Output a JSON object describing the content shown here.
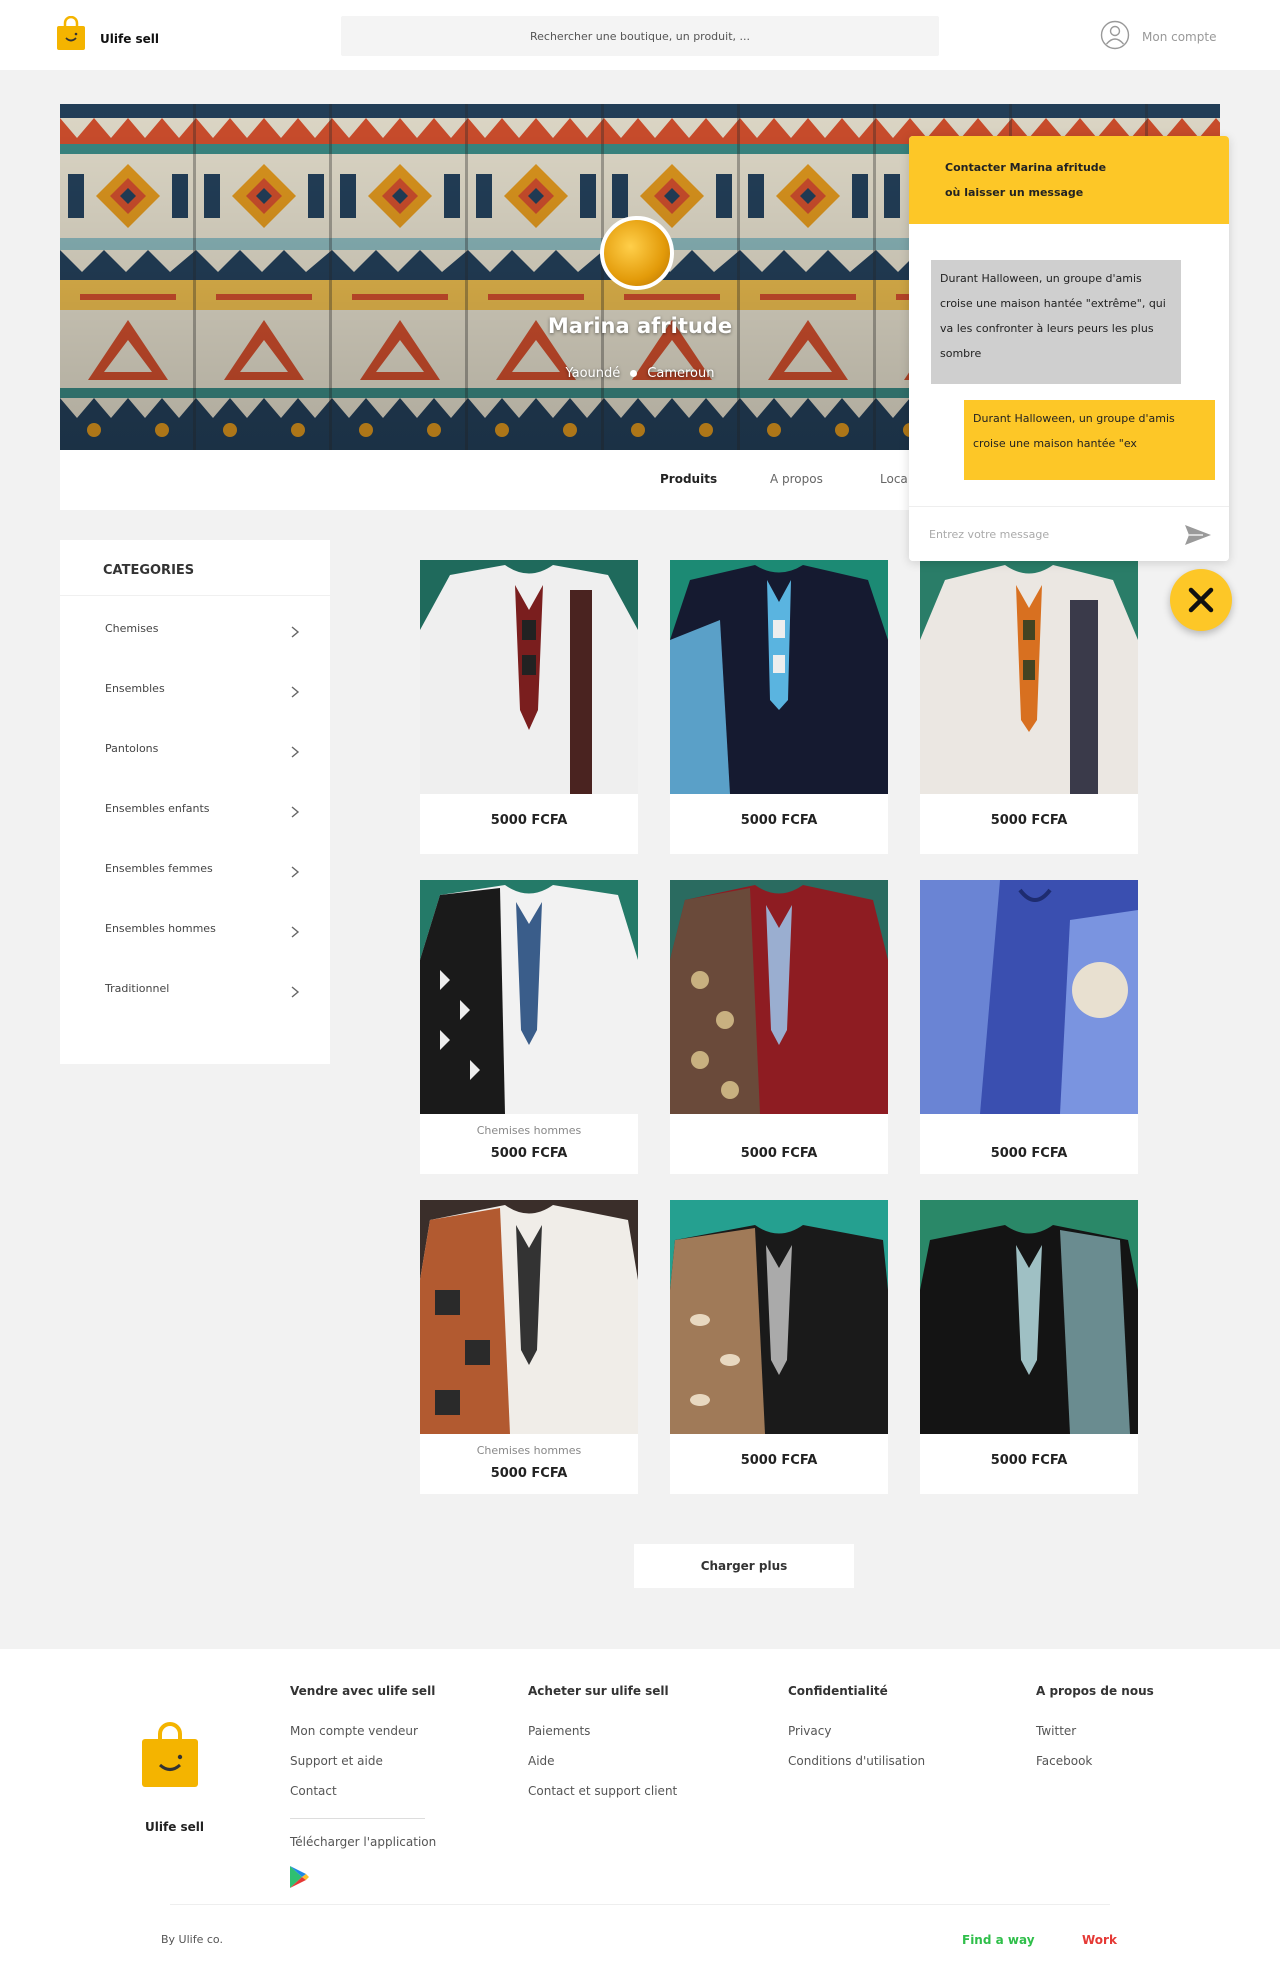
{
  "header": {
    "brand": "Ulife sell",
    "search_placeholder": "Rechercher une boutique, un produit, ...",
    "account_label": "Mon compte",
    "accent": "#fdc727"
  },
  "shop": {
    "name": "Marina afritude",
    "city": "Yaoundé",
    "country": "Cameroun"
  },
  "tabs": [
    "Produits",
    "A propos",
    "Loca"
  ],
  "categories": {
    "title": "CATEGORIES",
    "items": [
      "Chemises",
      "Ensembles",
      "Pantolons",
      "Ensembles enfants",
      "Ensembles femmes",
      "Ensembles hommes",
      "Traditionnel"
    ]
  },
  "products": [
    {
      "subtitle": "",
      "price": "5000 FCFA"
    },
    {
      "subtitle": "",
      "price": "5000 FCFA"
    },
    {
      "subtitle": "",
      "price": "5000 FCFA"
    },
    {
      "subtitle": "Chemises hommes",
      "price": "5000 FCFA"
    },
    {
      "subtitle": "",
      "price": "5000 FCFA"
    },
    {
      "subtitle": "",
      "price": "5000 FCFA"
    },
    {
      "subtitle": "Chemises hommes",
      "price": "5000 FCFA"
    },
    {
      "subtitle": "",
      "price": "5000 FCFA"
    },
    {
      "subtitle": "",
      "price": "5000 FCFA"
    }
  ],
  "load_more": "Charger plus",
  "chat": {
    "title_line1": "Contacter Marina afritude",
    "title_line2": "où laisser un message",
    "message_in": "Durant Halloween, un groupe d'amis croise une maison hantée \"extrême\", qui va les confronter à leurs peurs les plus sombre",
    "message_out": "Durant Halloween, un groupe d'amis croise une maison hantée \"ex",
    "input_placeholder": "Entrez votre message"
  },
  "footer": {
    "brand": "Ulife sell",
    "col1": {
      "title": "Vendre avec ulife sell",
      "links": [
        "Mon compte vendeur",
        "Support et aide",
        "Contact"
      ],
      "app": "Télécharger l'application"
    },
    "col2": {
      "title": "Acheter sur ulife sell",
      "links": [
        "Paiements",
        "Aide",
        "Contact et support client"
      ]
    },
    "col3": {
      "title": "Confidentialité",
      "links": [
        "Privacy",
        "Conditions d'utilisation"
      ]
    },
    "col4": {
      "title": "A propos de nous",
      "links": [
        "Twitter",
        "Facebook"
      ]
    },
    "copyright": "By Ulife co.",
    "find_a_way": "Find a way",
    "work": "Work"
  }
}
